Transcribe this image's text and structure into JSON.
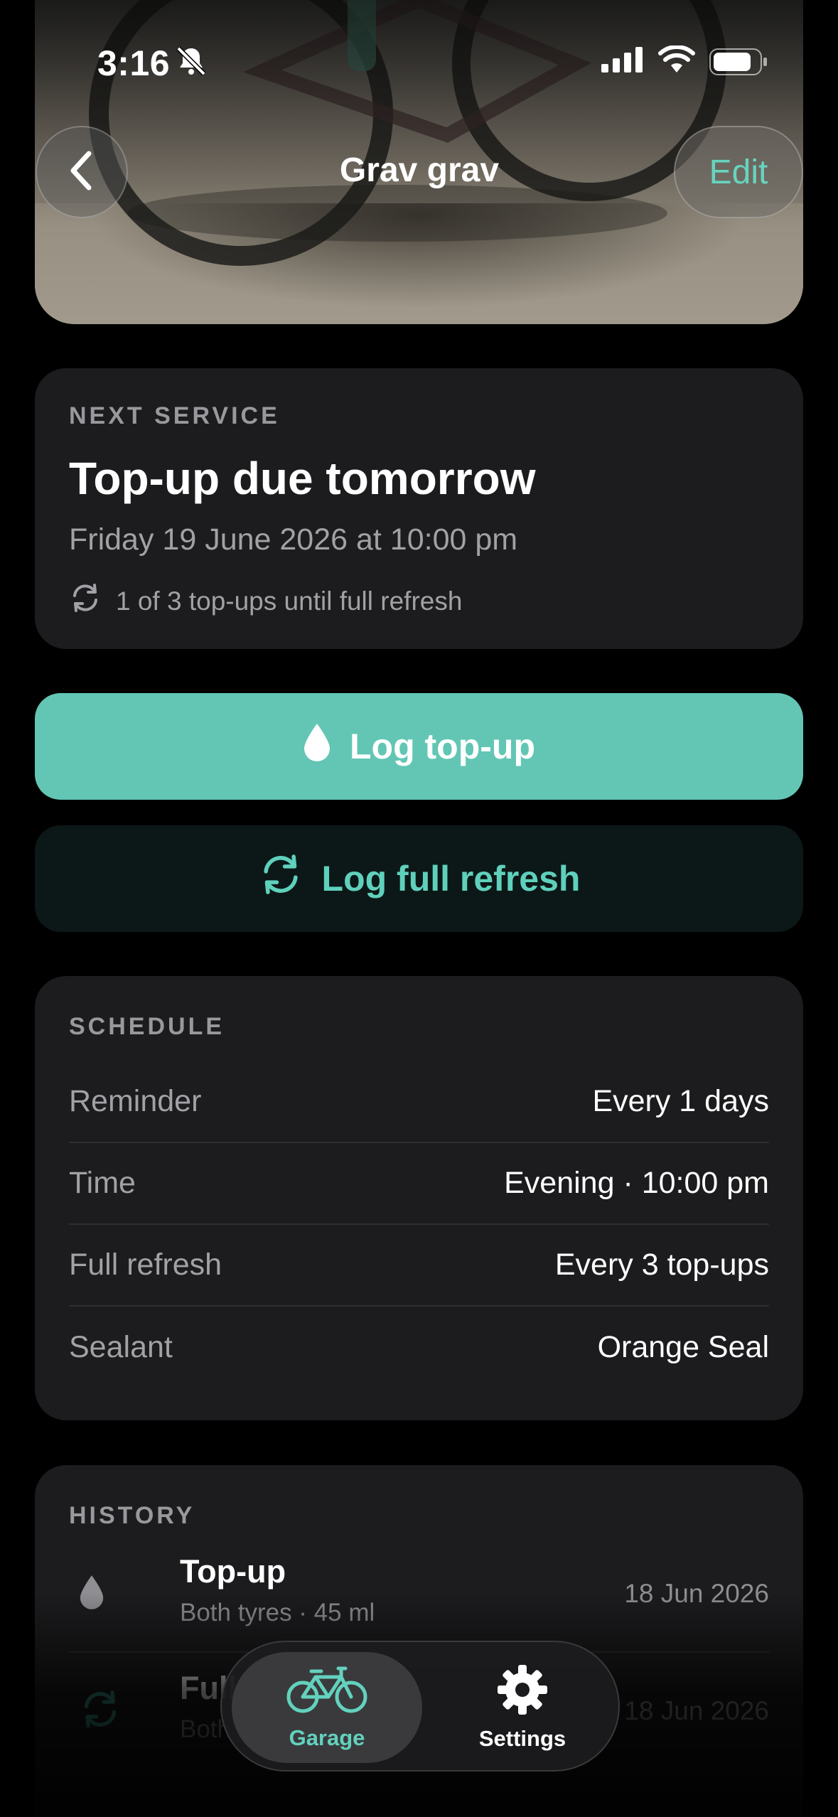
{
  "status_bar": {
    "time": "3:16"
  },
  "nav": {
    "title": "Grav grav",
    "edit_label": "Edit"
  },
  "next_service": {
    "label": "NEXT SERVICE",
    "headline": "Top-up due tomorrow",
    "when": "Friday 19 June 2026 at 10:00 pm",
    "cycle": "1 of 3 top-ups until full refresh"
  },
  "actions": {
    "primary": "Log top-up",
    "secondary": "Log full refresh"
  },
  "schedule": {
    "label": "SCHEDULE",
    "rows": [
      {
        "key": "Reminder",
        "value": "Every 1 days"
      },
      {
        "key": "Time",
        "value": "Evening · 10:00 pm"
      },
      {
        "key": "Full refresh",
        "value": "Every 3 top-ups"
      },
      {
        "key": "Sealant",
        "value": "Orange Seal"
      }
    ]
  },
  "history": {
    "label": "HISTORY",
    "items": [
      {
        "title": "Top-up",
        "subtitle": "Both tyres · 45 ml",
        "date": "18 Jun 2026",
        "icon": "drop-icon"
      },
      {
        "title": "Full refresh",
        "subtitle": "Both tyres",
        "date": "18 Jun 2026",
        "icon": "refresh-icon"
      }
    ]
  },
  "tabs": [
    {
      "label": "Garage",
      "icon": "bicycle-icon",
      "selected": true
    },
    {
      "label": "Settings",
      "icon": "gear-icon",
      "selected": false
    }
  ],
  "colors": {
    "accent": "#63c6b4",
    "card": "#1c1c1e",
    "background": "#000000"
  }
}
